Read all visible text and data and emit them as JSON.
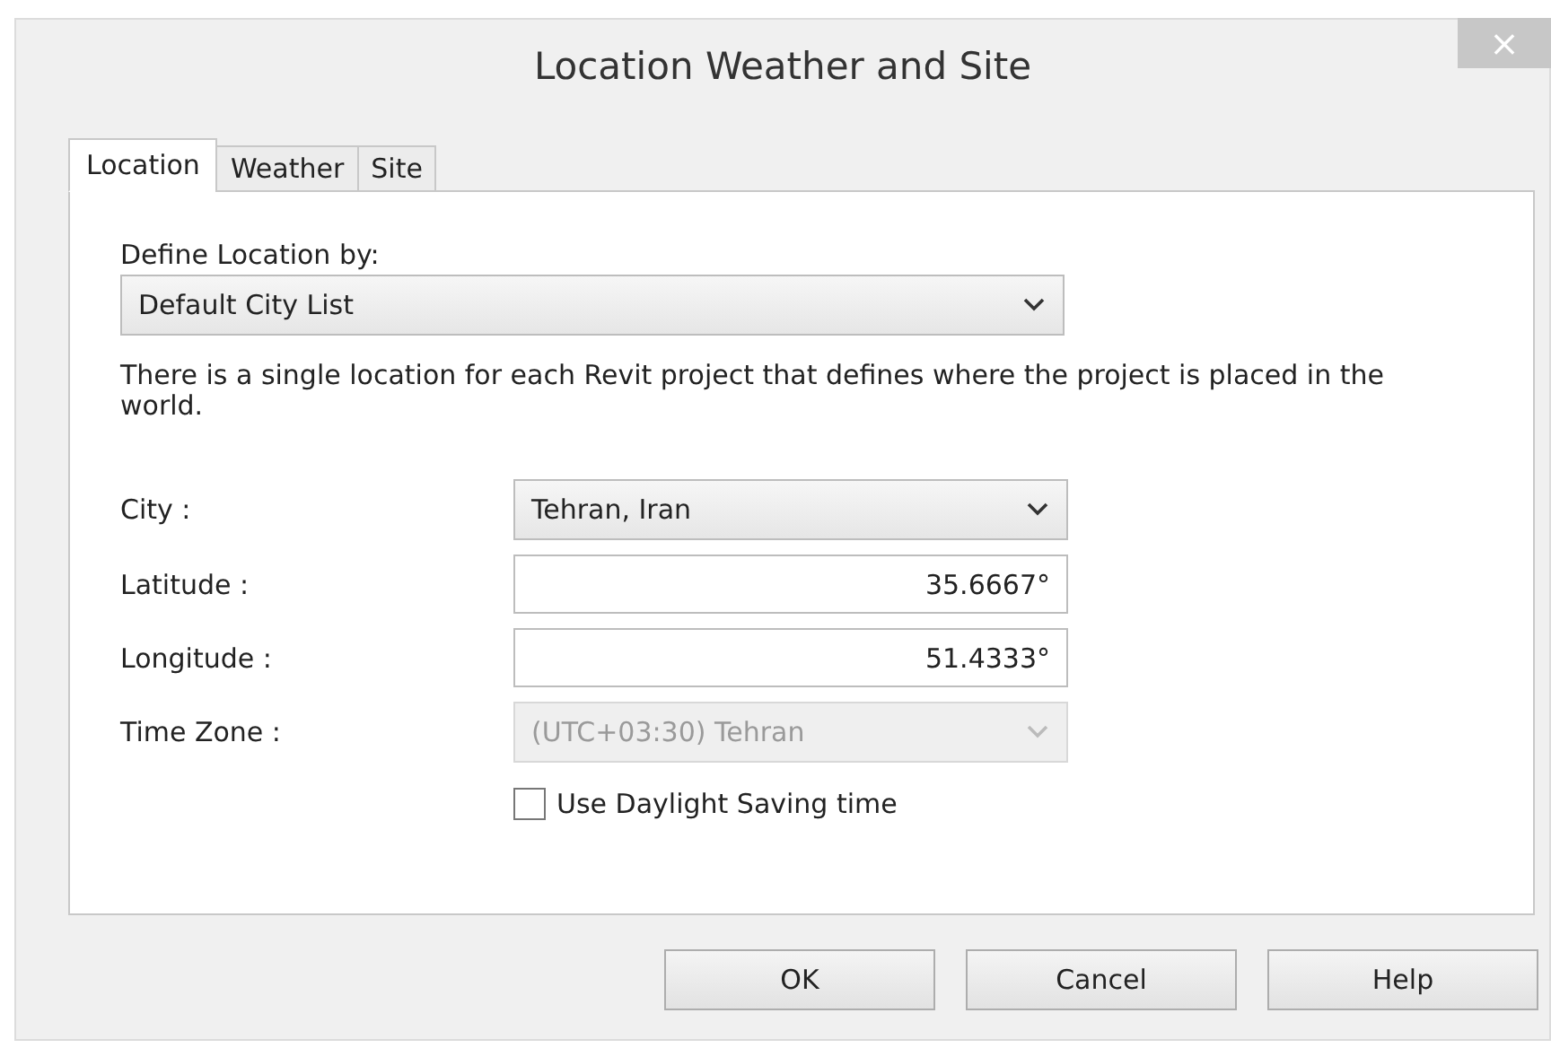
{
  "window": {
    "title": "Location Weather and Site",
    "close": "×"
  },
  "tabs": [
    {
      "label": "Location",
      "selected": true
    },
    {
      "label": "Weather",
      "selected": false
    },
    {
      "label": "Site",
      "selected": false
    }
  ],
  "define_by": {
    "label": "Define Location by:",
    "value": "Default City List"
  },
  "description": "There is a single location for each Revit project that defines where the project is placed in the world.",
  "fields": [
    {
      "kind": "dropdown",
      "label": "City :",
      "value": "Tehran, Iran",
      "disabled": false
    },
    {
      "kind": "text",
      "label": "Latitude :",
      "value": "35.6667°",
      "disabled": false
    },
    {
      "kind": "text",
      "label": "Longitude :",
      "value": "51.4333°",
      "disabled": false
    },
    {
      "kind": "dropdown",
      "label": "Time Zone :",
      "value": "(UTC+03:30) Tehran",
      "disabled": true
    }
  ],
  "daylight": {
    "label": "Use Daylight Saving time",
    "checked": false
  },
  "buttons": [
    "OK",
    "Cancel",
    "Help"
  ]
}
